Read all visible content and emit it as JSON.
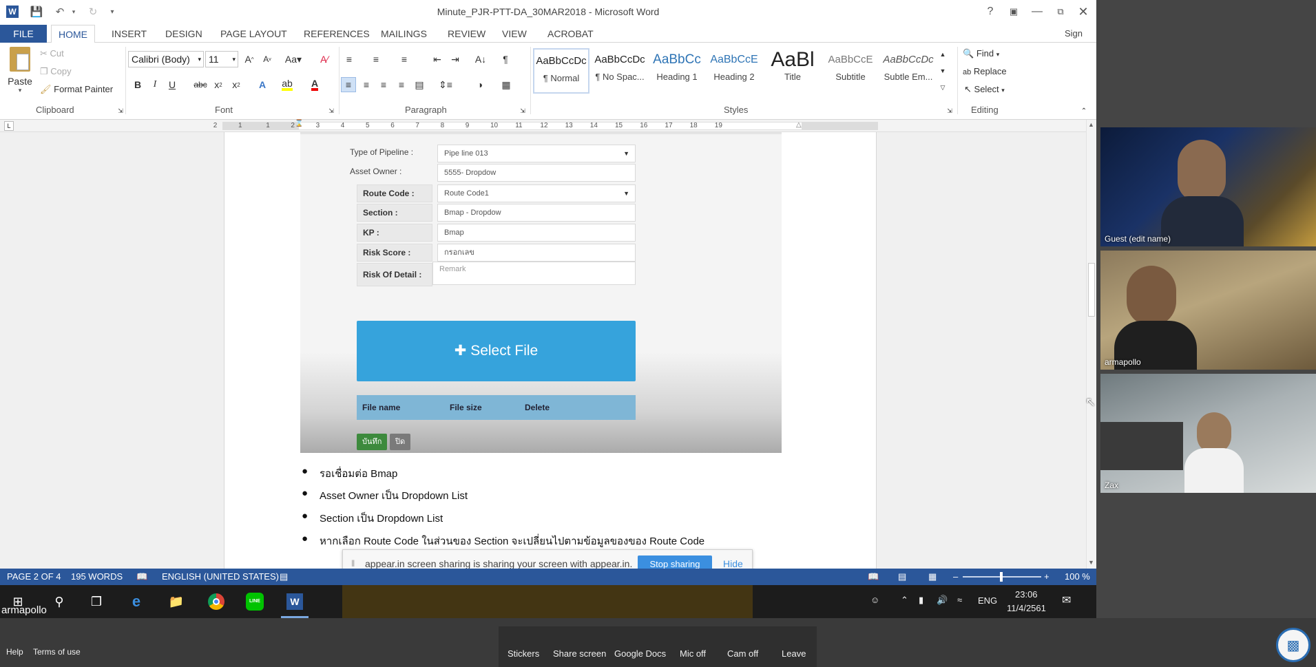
{
  "window": {
    "title": "Minute_PJR-PTT-DA_30MAR2018 - Microsoft Word",
    "sign_in": "Sign in"
  },
  "tabs": [
    "FILE",
    "HOME",
    "INSERT",
    "DESIGN",
    "PAGE LAYOUT",
    "REFERENCES",
    "MAILINGS",
    "REVIEW",
    "VIEW",
    "ACROBAT"
  ],
  "active_tab": "HOME",
  "clipboard": {
    "paste": "Paste",
    "cut": "Cut",
    "copy": "Copy",
    "format_painter": "Format Painter",
    "label": "Clipboard"
  },
  "font": {
    "name": "Calibri (Body)",
    "size": "11",
    "label": "Font"
  },
  "paragraph": {
    "label": "Paragraph"
  },
  "styles": {
    "label": "Styles",
    "items": [
      {
        "sample": "AaBbCcDc",
        "name": "¶ Normal"
      },
      {
        "sample": "AaBbCcDc",
        "name": "¶ No Spac..."
      },
      {
        "sample": "AaBbCc",
        "name": "Heading 1"
      },
      {
        "sample": "AaBbCcE",
        "name": "Heading 2"
      },
      {
        "sample": "AaBl",
        "name": "Title"
      },
      {
        "sample": "AaBbCcE",
        "name": "Subtitle"
      },
      {
        "sample": "AaBbCcDc",
        "name": "Subtle Em..."
      }
    ]
  },
  "editing": {
    "find": "Find",
    "replace": "Replace",
    "select": "Select",
    "label": "Editing"
  },
  "ruler_numbers": [
    "2",
    "1",
    "1",
    "2",
    "3",
    "4",
    "5",
    "6",
    "7",
    "8",
    "9",
    "10",
    "11",
    "12",
    "13",
    "14",
    "15",
    "16",
    "17",
    "18",
    "19"
  ],
  "embed_form": {
    "fields": [
      {
        "label": "Type of Pipeline :",
        "value": "Pipe line 013",
        "dropdown": true,
        "boxed": false
      },
      {
        "label": "Asset Owner :",
        "value": "5555- Dropdow",
        "dropdown": false,
        "boxed": false
      },
      {
        "label": "Route Code :",
        "value": "Route Code1",
        "dropdown": true,
        "boxed": true
      },
      {
        "label": "Section :",
        "value": "Bmap - Dropdow",
        "dropdown": false,
        "boxed": true
      },
      {
        "label": "KP :",
        "value": "Bmap",
        "dropdown": false,
        "boxed": true
      },
      {
        "label": "Risk Score :",
        "value": "กรอกเลข",
        "dropdown": false,
        "boxed": true
      }
    ],
    "risk_detail_label": "Risk Of Detail :",
    "risk_detail_placeholder": "Remark",
    "select_file": "Select File",
    "table_headers": [
      "File name",
      "File size",
      "Delete"
    ],
    "save_btn": "บันทึก",
    "close_btn": "ปิด"
  },
  "bullets": [
    "รอเชื่อมต่อ Bmap",
    "Asset Owner เป็น Dropdown List",
    "Section เป็น Dropdown List",
    "หากเลือก Route Code ในส่วนของ Section จะเปลี่ยนไปตามข้อมูลของของ Route Code"
  ],
  "share_bar": {
    "message": "appear.in screen sharing is sharing your screen with appear.in.",
    "stop": "Stop sharing",
    "hide": "Hide"
  },
  "status": {
    "page": "PAGE 2 OF 4",
    "words": "195 WORDS",
    "language": "ENGLISH (UNITED STATES)",
    "zoom": "100 %"
  },
  "taskbar": {
    "user": "armapollo",
    "lang": "ENG",
    "time": "23:06",
    "date": "11/4/2561"
  },
  "participants": [
    "Guest (edit name)",
    "armapollo",
    "Zax"
  ],
  "bottom_links": [
    "Help",
    "Terms of use"
  ],
  "controls": [
    "Stickers",
    "Share screen",
    "Google Docs",
    "Mic off",
    "Cam off",
    "Leave"
  ],
  "colors": {
    "word_blue": "#2b579a",
    "select_file": "#36a3dc",
    "stop_sharing": "#3b8fe0"
  }
}
